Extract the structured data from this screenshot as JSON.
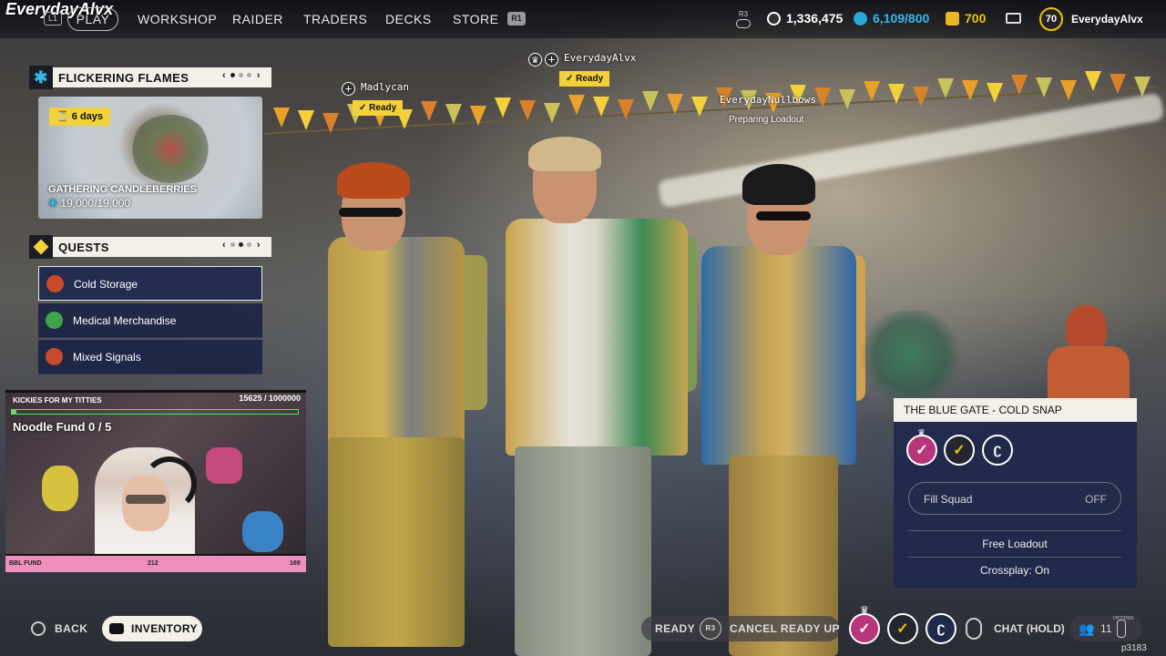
{
  "streamer_tag": "EverydayAlvx",
  "nav": {
    "l1": "L1",
    "r1": "R1",
    "items": [
      "PLAY",
      "WORKSHOP",
      "RAIDER",
      "TRADERS",
      "DECKS",
      "STORE"
    ]
  },
  "stats": {
    "r3": "R3",
    "currency1": "1,336,475",
    "currency2": "6,109/800",
    "currency3": "700",
    "level": "70",
    "username": "EverydayAlvx"
  },
  "event": {
    "header": "FLICKERING FLAMES",
    "timer": "6 days",
    "name": "GATHERING CANDLEBERRIES",
    "progress": "19,000/19,000"
  },
  "quests": {
    "header": "QUESTS",
    "items": [
      {
        "label": "Cold Storage",
        "color": "#c94a2a"
      },
      {
        "label": "Medical Merchandise",
        "color": "#3fa34a"
      },
      {
        "label": "Mixed Signals",
        "color": "#c94a2a"
      }
    ]
  },
  "webcam": {
    "goal": "KICKIES FOR MY TITTIES",
    "count": "15625 / 1000000",
    "fund": "Noodle Fund 0 / 5",
    "bar_left": "BBL FUND",
    "bar_mid": "212",
    "bar_right": "169",
    "progress": 0.016
  },
  "players": [
    {
      "name": "Madlycan",
      "status": "Ready"
    },
    {
      "name": "EverydayAlvx",
      "status": "Ready"
    },
    {
      "name": "EverydayNullbows",
      "status": "Preparing Loadout"
    }
  ],
  "squad": {
    "title": "THE BLUE GATE - COLD SNAP",
    "fill_label": "Fill Squad",
    "fill_value": "OFF",
    "row1": "Free Loadout",
    "row2": "Crossplay: On"
  },
  "bottom": {
    "back": "BACK",
    "inventory": "INVENTORY",
    "ready": "READY",
    "r3": "R3",
    "cancel": "CANCEL READY UP",
    "chat": "CHAT (HOLD)",
    "friends": "11",
    "options": "OPTIONS",
    "build": "p3183"
  },
  "colors": {
    "accent_yellow": "#f2d13a",
    "panel_blue": "#1c2850",
    "header_cream": "#f2f0e8",
    "blue_coin": "#29a6d9",
    "gold_coin": "#e8b923"
  }
}
